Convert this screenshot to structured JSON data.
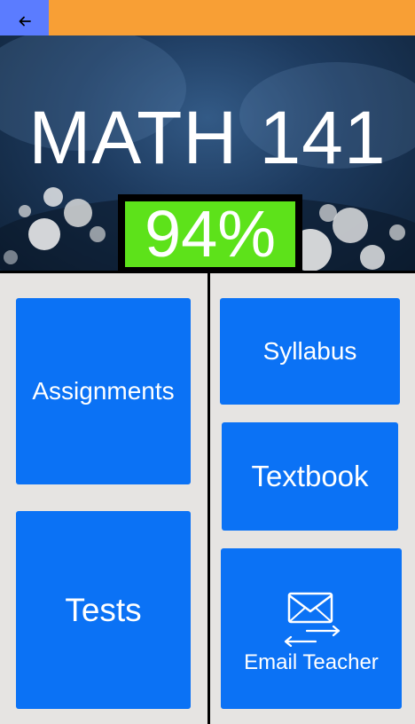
{
  "header": {
    "back_icon": "arrow-left-icon",
    "bar_color": "#f89f35",
    "back_button_color": "#5b7cff"
  },
  "hero": {
    "course_title": "MATH 141",
    "grade": "94%",
    "grade_color": "#5de21a"
  },
  "tiles": {
    "assignments": "Assignments",
    "tests": "Tests",
    "syllabus": "Syllabus",
    "textbook": "Textbook",
    "email_teacher": "Email Teacher",
    "email_icon": "envelope-exchange-icon",
    "tile_color": "#0b72f5"
  }
}
